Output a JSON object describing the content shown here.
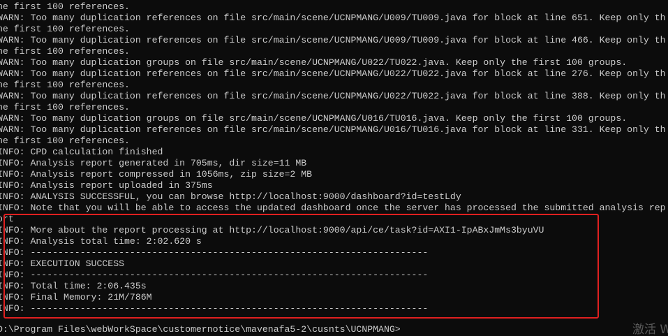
{
  "terminal": {
    "lines": [
      "he first 100 references.",
      "WARN: Too many duplication references on file src/main/scene/UCNPMANG/U009/TU009.java for block at line 651. Keep only th",
      "he first 100 references.",
      "WARN: Too many duplication references on file src/main/scene/UCNPMANG/U009/TU009.java for block at line 466. Keep only th",
      "he first 100 references.",
      "WARN: Too many duplication groups on file src/main/scene/UCNPMANG/U022/TU022.java. Keep only the first 100 groups.",
      "WARN: Too many duplication references on file src/main/scene/UCNPMANG/U022/TU022.java for block at line 276. Keep only th",
      "he first 100 references.",
      "WARN: Too many duplication references on file src/main/scene/UCNPMANG/U022/TU022.java for block at line 388. Keep only th",
      "he first 100 references.",
      "WARN: Too many duplication groups on file src/main/scene/UCNPMANG/U016/TU016.java. Keep only the first 100 groups.",
      "WARN: Too many duplication references on file src/main/scene/UCNPMANG/U016/TU016.java for block at line 331. Keep only th",
      "he first 100 references.",
      "INFO: CPD calculation finished",
      "INFO: Analysis report generated in 705ms, dir size=11 MB",
      "INFO: Analysis report compressed in 1056ms, zip size=2 MB",
      "INFO: Analysis report uploaded in 375ms",
      "INFO: ANALYSIS SUCCESSFUL, you can browse http://localhost:9000/dashboard?id=testLdy",
      "INFO: Note that you will be able to access the updated dashboard once the server has processed the submitted analysis rep",
      "ort",
      "INFO: More about the report processing at http://localhost:9000/api/ce/task?id=AXI1-IpABxJmMs3byuVU",
      "INFO: Analysis total time: 2:02.620 s",
      "INFO: ------------------------------------------------------------------------",
      "INFO: EXECUTION SUCCESS",
      "INFO: ------------------------------------------------------------------------",
      "INFO: Total time: 2:06.435s",
      "INFO: Final Memory: 21M/786M",
      "INFO: ------------------------------------------------------------------------"
    ],
    "prompt": "D:\\Program Files\\webWorkSpace\\customernotice\\mavenafa5-2\\cusnts\\UCNPMANG>"
  },
  "colors": {
    "background": "#0c0c0c",
    "text": "#cccccc",
    "highlight_border": "#e02020",
    "watermark": "#5a5a5a"
  },
  "watermark": {
    "text": "激活 W"
  }
}
